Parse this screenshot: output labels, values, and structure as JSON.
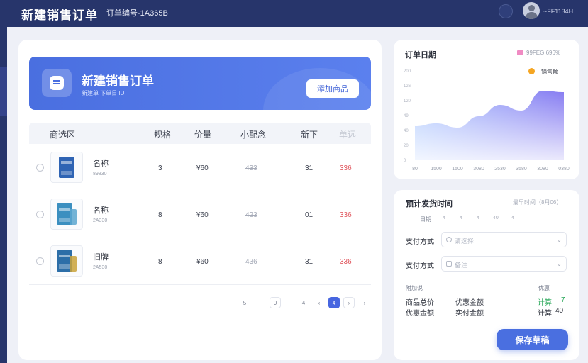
{
  "header": {
    "app_title": "新建销售订单",
    "order_no": "订单编号-1A365B",
    "user_label": "~FF1134H"
  },
  "banner": {
    "title": "新建销售订单",
    "subtitle": "新建单 下单日 ID",
    "add_button": "添加商品"
  },
  "table": {
    "headers": [
      "商选区",
      "规格",
      "价量",
      "小配念",
      "新下",
      "单远"
    ],
    "rows": [
      {
        "name": "名称",
        "code": "89830",
        "spec": "3",
        "price": "¥60",
        "sub": "433",
        "qty": "31",
        "total": "336",
        "color": "#2f64b4"
      },
      {
        "name": "名称",
        "code": "2A330",
        "spec": "8",
        "price": "¥60",
        "sub": "423",
        "qty": "01",
        "total": "336",
        "color": "#3b8fc0"
      },
      {
        "name": "旧牌",
        "code": "2A530",
        "spec": "8",
        "price": "¥60",
        "sub": "436",
        "qty": "31",
        "total": "336",
        "color": "#2c6ea8"
      }
    ]
  },
  "pagination": {
    "left_labels": [
      "5",
      "0",
      "4"
    ],
    "current": "4"
  },
  "chart": {
    "title": "订单日期",
    "legend1": "99FEG 696%",
    "legend2": "销售额",
    "chart_data": {
      "type": "area",
      "x": [
        "80",
        "1500",
        "1500",
        "3080",
        "2530",
        "3580",
        "3080",
        "0380"
      ],
      "yticks": [
        "200",
        "126",
        "120",
        "49",
        "40",
        "20",
        "0"
      ],
      "values": [
        48,
        52,
        46,
        62,
        78,
        70,
        98,
        96
      ],
      "ylim": [
        0,
        110
      ],
      "grid": false,
      "legend": "top-right",
      "colors": [
        "#7b6ff0",
        "#a9c6ff"
      ]
    }
  },
  "shipping": {
    "title": "预计发货时间",
    "hint": "最早时间（8月06）",
    "day_label": "日期",
    "days": [
      "4",
      "4",
      "4",
      "40",
      "4"
    ],
    "payment_label": "支付方式",
    "payment_placeholder": "请选择",
    "remark_label": "支付方式",
    "remark_placeholder": "备注",
    "summary_left_head": "附加说",
    "summary_right_head": "优惠",
    "rows": [
      {
        "a": "商品总价",
        "b": "优惠金额",
        "c": "计算",
        "d": "7"
      },
      {
        "a": "优惠金额",
        "b": "实付金额",
        "c": "计算",
        "d": "40"
      }
    ],
    "save_button": "保存草稿"
  }
}
